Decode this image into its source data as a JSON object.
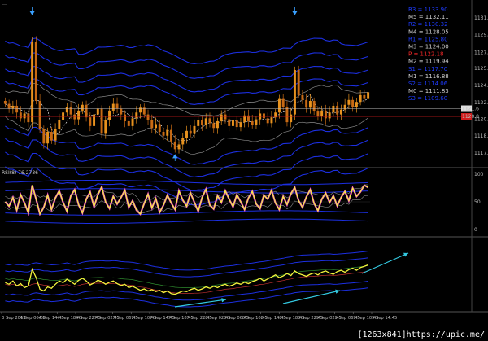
{
  "header": {
    "title": "…"
  },
  "watermark": "[1263x841]https://upic.me/",
  "colors": {
    "background": "#000000",
    "bull_candle": "#e8921e",
    "bear_candle": "#c86a14",
    "band_blue": "#1c2fe0",
    "band_gray": "#8a8a8a",
    "signal_yellow": "#f4f43c",
    "signal_magenta": "#e83cd6",
    "trend_arrow": "#33c8e0",
    "red_line": "#d01c1c",
    "pivot_blue": "#1e3cff",
    "pivot_red": "#ff2a2a",
    "pivot_white": "#d0d0d0"
  },
  "chart_data": [
    {
      "type": "candlestick",
      "title": "",
      "ylim": [
        1116.0,
        1132.0
      ],
      "price_axis_ticks": [
        1131.0,
        1129.25,
        1127.4,
        1125.75,
        1124.0,
        1122.25,
        1120.5,
        1118.8,
        1117.0
      ],
      "current_price": 1121.6,
      "red_line_price": 1120.8,
      "pivot_levels": [
        {
          "label": "R3 = 1133.90",
          "color": "#1e3cff"
        },
        {
          "label": "M5 = 1132.11",
          "color": "#d0d0d0"
        },
        {
          "label": "R2 = 1130.32",
          "color": "#1e3cff"
        },
        {
          "label": "M4 = 1128.05",
          "color": "#d0d0d0"
        },
        {
          "label": "R1 = 1125.80",
          "color": "#1e3cff"
        },
        {
          "label": "M3 = 1124.00",
          "color": "#d0d0d0"
        },
        {
          "label": "P = 1122.18",
          "color": "#ff2a2a"
        },
        {
          "label": "M2 = 1119.94",
          "color": "#d0d0d0"
        },
        {
          "label": "S1 = 1117.70",
          "color": "#1e3cff"
        },
        {
          "label": "M1 = 1116.88",
          "color": "#d0d0d0"
        },
        {
          "label": "S2 = 1114.06",
          "color": "#1e3cff"
        },
        {
          "label": "M0 = 1111.83",
          "color": "#d0d0d0"
        },
        {
          "label": "S3 = 1109.60",
          "color": "#1e3cff"
        }
      ],
      "close": [
        1122.1,
        1121.6,
        1121.9,
        1121.2,
        1120.6,
        1121.1,
        1120.2,
        1128.5,
        1122.4,
        1119.5,
        1118.0,
        1119.2,
        1118.3,
        1119.5,
        1120.4,
        1121.2,
        1121.8,
        1121.0,
        1120.5,
        1121.4,
        1122.0,
        1120.7,
        1119.8,
        1121.0,
        1121.6,
        1119.0,
        1120.4,
        1121.4,
        1122.1,
        1121.6,
        1121.0,
        1120.3,
        1119.8,
        1120.6,
        1121.2,
        1121.7,
        1121.0,
        1120.4,
        1119.6,
        1120.0,
        1119.2,
        1118.8,
        1119.4,
        1118.2,
        1117.4,
        1117.9,
        1118.6,
        1119.3,
        1119.0,
        1119.8,
        1120.4,
        1119.9,
        1120.6,
        1120.1,
        1119.6,
        1120.3,
        1121.0,
        1120.5,
        1119.8,
        1120.4,
        1119.7,
        1120.2,
        1120.9,
        1120.3,
        1119.9,
        1120.5,
        1121.1,
        1120.6,
        1120.1,
        1120.7,
        1121.2,
        1122.6,
        1121.8,
        1120.2,
        1121.0,
        1125.6,
        1123.0,
        1122.5,
        1121.7,
        1122.4,
        1121.3,
        1120.8,
        1121.4,
        1120.6,
        1121.2,
        1121.9,
        1121.0,
        1121.5,
        1122.0,
        1122.5,
        1121.8,
        1122.3,
        1123.0,
        1122.6,
        1123.3
      ],
      "rsi": {
        "label": "RSI(8) 76.2736",
        "ylim": [
          0,
          100
        ],
        "values": [
          50,
          42,
          58,
          35,
          63,
          48,
          30,
          80,
          55,
          28,
          40,
          62,
          36,
          57,
          70,
          49,
          33,
          61,
          72,
          45,
          30,
          55,
          68,
          41,
          63,
          77,
          50,
          38,
          60,
          46,
          58,
          71,
          40,
          52,
          35,
          28,
          47,
          64,
          39,
          56,
          31,
          44,
          62,
          48,
          36,
          70,
          53,
          42,
          66,
          49,
          33,
          58,
          73,
          44,
          37,
          61,
          49,
          70,
          55,
          41,
          63,
          50,
          36,
          57,
          69,
          46,
          38,
          62,
          55,
          71,
          48,
          36,
          60,
          45,
          65,
          76,
          52,
          40,
          59,
          72,
          47,
          34,
          55,
          66,
          49,
          61,
          43,
          58,
          69,
          52,
          75,
          60,
          68,
          80,
          76
        ]
      },
      "momentum": {
        "ylim": [
          -1,
          1
        ],
        "values": [
          -0.25,
          -0.3,
          -0.2,
          -0.35,
          -0.28,
          -0.4,
          -0.35,
          0.15,
          -0.1,
          -0.45,
          -0.5,
          -0.38,
          -0.42,
          -0.3,
          -0.2,
          -0.25,
          -0.15,
          -0.22,
          -0.3,
          -0.18,
          -0.12,
          -0.2,
          -0.32,
          -0.26,
          -0.18,
          -0.22,
          -0.3,
          -0.24,
          -0.2,
          -0.28,
          -0.34,
          -0.3,
          -0.4,
          -0.36,
          -0.42,
          -0.48,
          -0.44,
          -0.5,
          -0.46,
          -0.52,
          -0.48,
          -0.55,
          -0.5,
          -0.58,
          -0.6,
          -0.55,
          -0.5,
          -0.52,
          -0.46,
          -0.42,
          -0.48,
          -0.44,
          -0.38,
          -0.42,
          -0.36,
          -0.4,
          -0.34,
          -0.3,
          -0.36,
          -0.32,
          -0.26,
          -0.3,
          -0.24,
          -0.28,
          -0.22,
          -0.18,
          -0.12,
          -0.2,
          -0.14,
          -0.08,
          -0.02,
          -0.1,
          -0.05,
          0.02,
          -0.04,
          0.1,
          0.02,
          -0.02,
          -0.06,
          0.0,
          0.04,
          -0.02,
          0.06,
          0.1,
          0.04,
          0.0,
          0.08,
          0.12,
          0.06,
          0.14,
          0.18,
          0.12,
          0.2,
          0.24,
          0.28
        ]
      },
      "time_labels": [
        "3 Sep 2015",
        "4 Sep 06:00",
        "4 Sep 14:45",
        "4 Sep 18:45",
        "4 Sep 22:45",
        "7 Sep 02:45",
        "7 Sep 06:45",
        "7 Sep 10:45",
        "7 Sep 14:45",
        "7 Sep 18:45",
        "7 Sep 22:45",
        "8 Sep 02:45",
        "8 Sep 06:45",
        "8 Sep 10:45",
        "8 Sep 14:45",
        "8 Sep 18:45",
        "8 Sep 22:45",
        "9 Sep 02:45",
        "9 Sep 06:45",
        "9 Sep 10:45",
        "9 Sep 14:45"
      ]
    }
  ]
}
